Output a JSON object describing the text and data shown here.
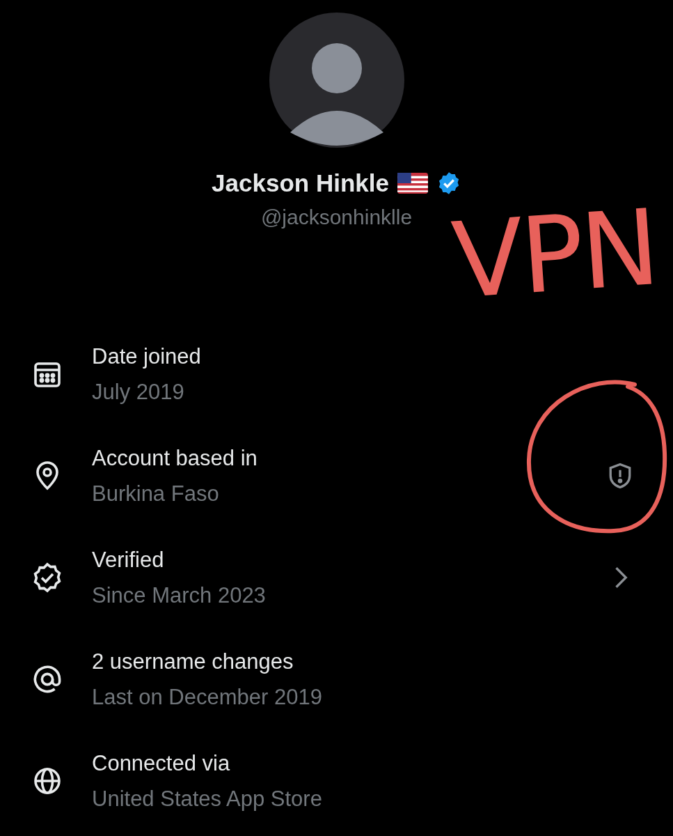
{
  "profile": {
    "name": "Jackson Hinkle",
    "handle": "@jacksonhinklle",
    "verified": true
  },
  "details": [
    {
      "kind": "calendar",
      "title": "Date joined",
      "subtitle": "July 2019"
    },
    {
      "kind": "location",
      "title": "Account based in",
      "subtitle": "Burkina Faso",
      "trailing": {
        "kind": "shield"
      }
    },
    {
      "kind": "verified",
      "title": "Verified",
      "subtitle": "Since March 2023",
      "trailing": {
        "kind": "chevron"
      }
    },
    {
      "kind": "at",
      "title": "2 username changes",
      "subtitle": "Last on December 2019"
    },
    {
      "kind": "globe",
      "title": "Connected via",
      "subtitle": "United States App Store"
    }
  ],
  "annotation": {
    "text": "VPN"
  }
}
